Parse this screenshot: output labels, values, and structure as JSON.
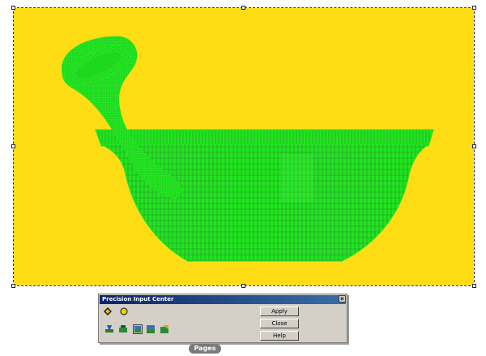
{
  "colors": {
    "page_background": "#ffdd14",
    "model_color": "#1ee61e",
    "mesh_line_color": "#2a8a2a"
  },
  "viewport": {
    "model_name_icon": "mortar-and-pestle-wireframe"
  },
  "dialog": {
    "title": "Precision Input Center",
    "close_label": "×",
    "apply_label": "Apply",
    "close_button_label": "Close",
    "help_label": "Help",
    "tool_icons": [
      "plane-diamond-icon",
      "circle-icon",
      "layer-tool-1-icon",
      "layer-tool-2-icon",
      "layer-tool-3-icon",
      "layer-tool-4-icon",
      "layer-tool-5-icon"
    ]
  },
  "pages_tab": {
    "label": "Pages"
  }
}
